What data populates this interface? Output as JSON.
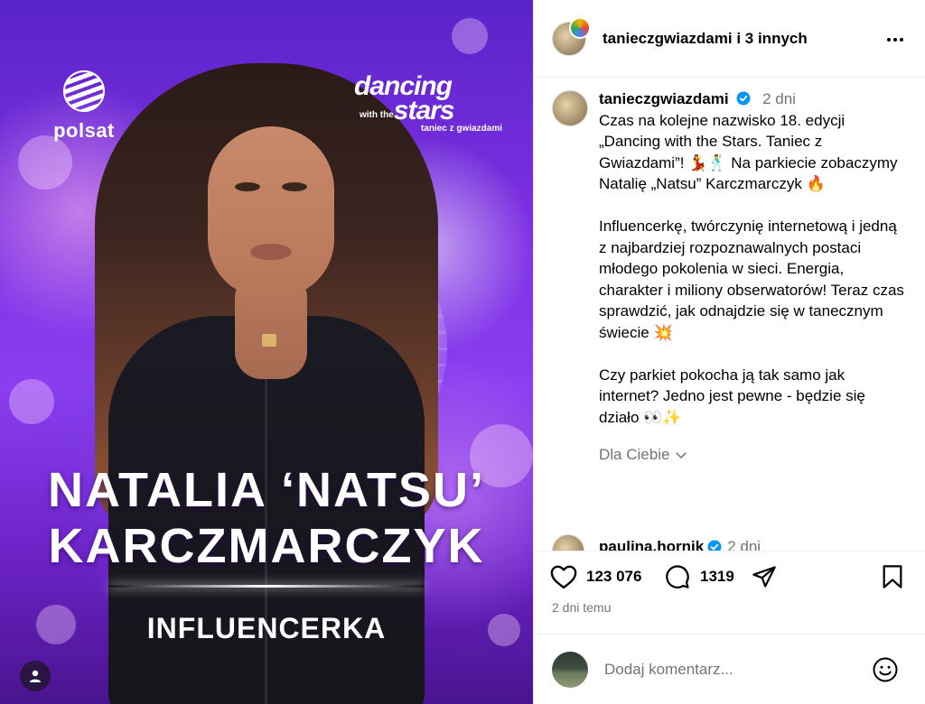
{
  "post_image": {
    "brand_logo_text": "polsat",
    "show_logo": {
      "line1": "dancing",
      "line2": "with the",
      "line3": "stars",
      "line4": "taniec z gwiazdami"
    },
    "headline_line1": "NATALIA ‘NATSU’",
    "headline_line2": "KARCZMARCZYK",
    "subtitle": "INFLUENCERKA"
  },
  "header": {
    "author": "tanieczgwiazdami",
    "collab_suffix": " i 3 innych",
    "more_icon": "more-horizontal-icon"
  },
  "caption": {
    "username": "tanieczgwiazdami",
    "time": "2 dni",
    "paragraph1": "Czas na kolejne nazwisko 18. edycji „Dancing with the Stars. Taniec z Gwiazdami”! 💃🕺 Na parkiecie zobaczymy Natalię „Natsu” Karczmarczyk 🔥",
    "paragraph2": "Influencerkę, twórczynię internetową i jedną z najbardziej rozpoznawalnych postaci młodego pokolenia w sieci. Energia, charakter i miliony obserwatorów! Teraz czas sprawdzić, jak odnajdzie się w tanecznym świecie 💥",
    "paragraph3": "Czy parkiet pokocha ją tak samo jak internet? Jedno jest pewne - będzie się działo 👀✨",
    "translation_label": "Dla Ciebie"
  },
  "comment_preview": {
    "username": "paulina.hornik",
    "time": "2 dni"
  },
  "actions": {
    "likes": "123 076",
    "comments": "1319",
    "posted_ago": "2 dni temu"
  },
  "add_comment": {
    "placeholder": "Dodaj komentarz..."
  },
  "colors": {
    "verified": "#0095f6",
    "muted_text": "#737373",
    "divider": "#efefef",
    "media_purple": "#7b2fe0"
  }
}
